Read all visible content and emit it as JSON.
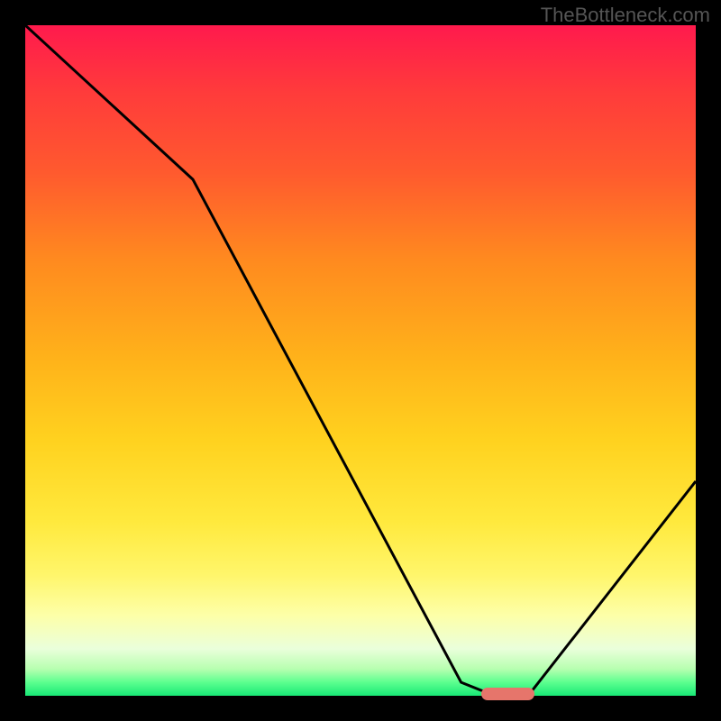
{
  "watermark": "TheBottleneck.com",
  "chart_data": {
    "type": "line",
    "title": "",
    "xlabel": "",
    "ylabel": "",
    "xlim": [
      0,
      100
    ],
    "ylim": [
      0,
      100
    ],
    "x": [
      0,
      25,
      65,
      70,
      75,
      100
    ],
    "values": [
      100,
      77,
      2,
      0,
      0,
      32
    ],
    "marker": {
      "x_start": 68,
      "x_end": 76,
      "y": 0
    },
    "gradient_stops": [
      {
        "pos": 0,
        "color": "#ff1a4d"
      },
      {
        "pos": 50,
        "color": "#ffb31a"
      },
      {
        "pos": 88,
        "color": "#fdffa8"
      },
      {
        "pos": 100,
        "color": "#18e876"
      }
    ]
  }
}
